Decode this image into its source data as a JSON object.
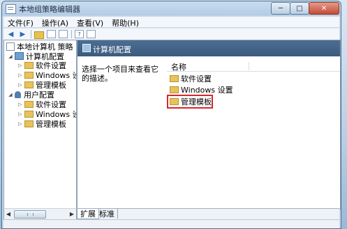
{
  "window": {
    "title": "本地组策略编辑器",
    "controls": {
      "minimize": "─",
      "maximize": "□",
      "close": "✕"
    }
  },
  "menu": [
    "文件(F)",
    "操作(A)",
    "查看(V)",
    "帮助(H)"
  ],
  "toolbar": {
    "icons": [
      "back-arrow-icon",
      "forward-arrow-icon",
      "up-folder-icon",
      "show-tree-icon",
      "export-icon",
      "help-icon",
      "properties-icon"
    ],
    "back_glyph": "◀",
    "forward_glyph": "▶",
    "help_glyph": "?"
  },
  "tree": {
    "root": "本地计算机 策略",
    "computer_config": "计算机配置",
    "computer_children": [
      "软件设置",
      "Windows 设",
      "管理模板"
    ],
    "user_config": "用户配置",
    "user_children": [
      "软件设置",
      "Windows 设",
      "管理模板"
    ]
  },
  "right_pane": {
    "header": "计算机配置",
    "description": "选择一个项目来查看它的描述。",
    "column_name": "名称",
    "items": [
      "软件设置",
      "Windows 设置",
      "管理模板"
    ],
    "highlighted_item": "管理模板"
  },
  "tabs": [
    "扩展",
    "标准"
  ],
  "colors": {
    "highlight": "#d7262c",
    "header_bg": "#3f5f82"
  }
}
